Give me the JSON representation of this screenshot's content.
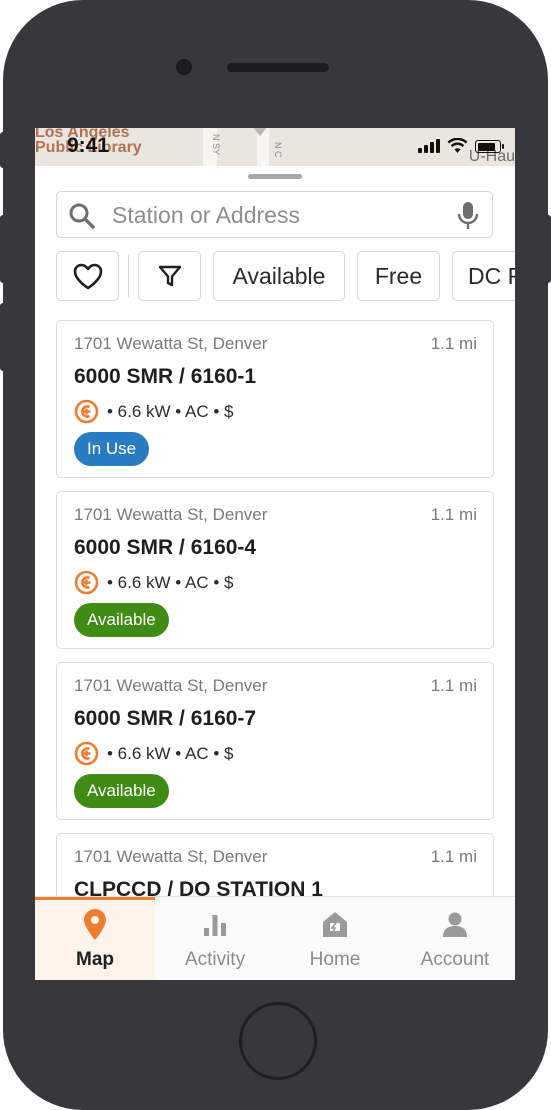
{
  "status_bar": {
    "time": "9:41"
  },
  "map": {
    "label_line1": "Los Angeles",
    "label_line2": "Public Library",
    "street_1": "N SY",
    "street_2": "N C",
    "poi": "U-Hau"
  },
  "search": {
    "placeholder": "Station or Address",
    "value": ""
  },
  "filters": [
    {
      "label": ""
    },
    {
      "label": ""
    },
    {
      "label": "Available"
    },
    {
      "label": "Free"
    },
    {
      "label": "DC F"
    }
  ],
  "stations": [
    {
      "address": "1701 Wewatta St, Denver",
      "distance": "1.1 mi",
      "name": "6000 SMR / 6160-1",
      "specs": "• 6.6 kW • AC • $",
      "status": "In Use",
      "status_color": "#2a7cc2"
    },
    {
      "address": "1701 Wewatta St, Denver",
      "distance": "1.1 mi",
      "name": "6000 SMR / 6160-4",
      "specs": "• 6.6 kW • AC • $",
      "status": "Available",
      "status_color": "#3f8b14"
    },
    {
      "address": "1701 Wewatta St, Denver",
      "distance": "1.1 mi",
      "name": "6000 SMR / 6160-7",
      "specs": "• 6.6 kW • AC • $",
      "status": "Available",
      "status_color": "#3f8b14"
    },
    {
      "address": "1701 Wewatta St, Denver",
      "distance": "1.1 mi",
      "name": "CLPCCD / DO STATION 1",
      "specs": "",
      "status": "",
      "status_color": ""
    }
  ],
  "tabs": [
    {
      "label": "Map",
      "icon": "map-pin-icon",
      "active": true
    },
    {
      "label": "Activity",
      "icon": "bar-chart-icon",
      "active": false
    },
    {
      "label": "Home",
      "icon": "home-charger-icon",
      "active": false
    },
    {
      "label": "Account",
      "icon": "person-icon",
      "active": false
    }
  ],
  "colors": {
    "accent": "#ee7d32",
    "in_use": "#2a7cc2",
    "available": "#3f8b14"
  }
}
